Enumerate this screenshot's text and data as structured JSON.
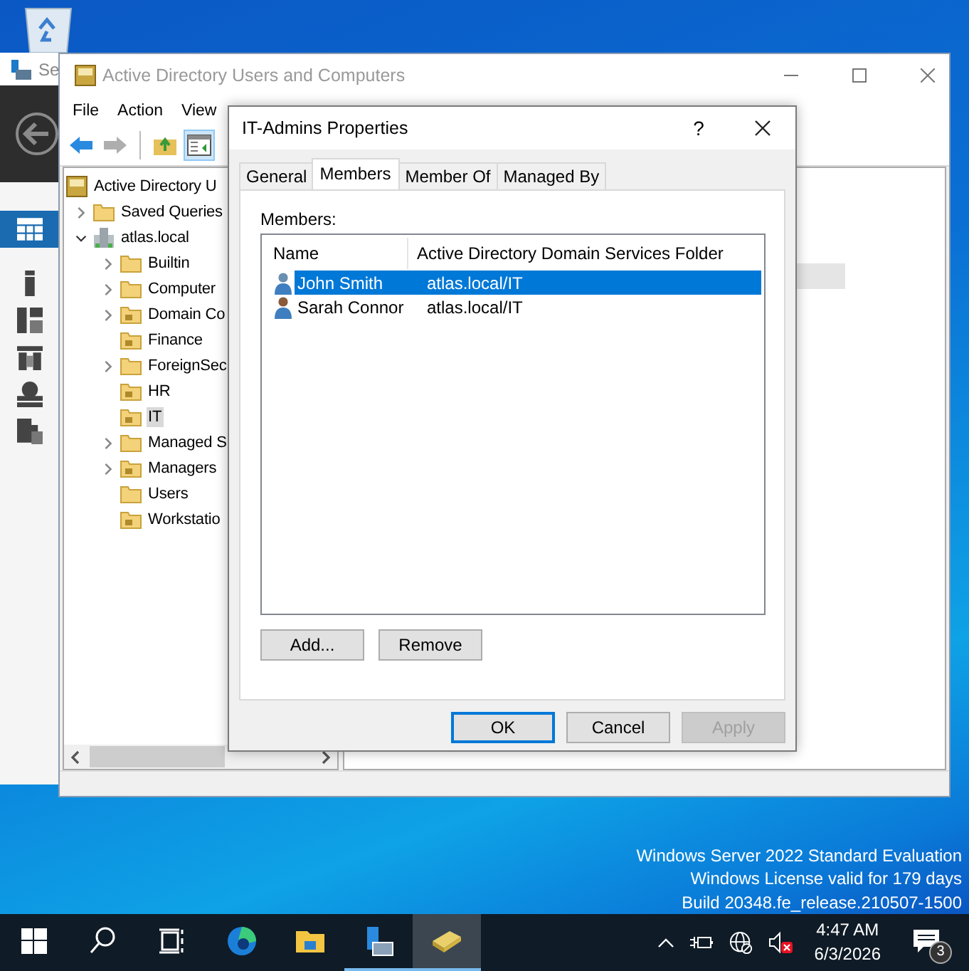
{
  "desktop": {
    "edition_text": [
      "Windows Server 2022 Standard Evaluation",
      "Windows License valid for 179 days",
      "Build 20348.fe_release.210507-1500"
    ]
  },
  "server_manager": {
    "title": "Se",
    "nav_items": [
      {
        "kind": "dashboard",
        "selected": true
      },
      {
        "kind": "server",
        "selected": false
      },
      {
        "kind": "servers",
        "selected": false
      },
      {
        "kind": "roles",
        "selected": false
      },
      {
        "kind": "network",
        "selected": false
      },
      {
        "kind": "storage",
        "selected": false
      }
    ]
  },
  "aduc": {
    "title": "Active Directory Users and Computers",
    "menu": [
      "File",
      "Action",
      "View"
    ],
    "toolbar": [
      {
        "kind": "back",
        "disabled": false,
        "pressed": false
      },
      {
        "kind": "forward",
        "disabled": true,
        "pressed": false
      },
      {
        "kind": "up",
        "disabled": false,
        "pressed": false
      },
      {
        "kind": "console-tree",
        "disabled": false,
        "pressed": true
      }
    ],
    "tree": [
      {
        "label": "Active Directory U",
        "kind": "root",
        "expandable": false,
        "selected": false,
        "children": [
          {
            "label": "Saved Queries",
            "kind": "folder",
            "expandable": true,
            "expanded": false,
            "selected": false
          },
          {
            "label": "atlas.local",
            "kind": "domain",
            "expandable": true,
            "expanded": true,
            "selected": false,
            "children": [
              {
                "label": "Builtin",
                "kind": "folder",
                "expandable": true,
                "expanded": false,
                "selected": false
              },
              {
                "label": "Computer",
                "kind": "folder",
                "expandable": true,
                "expanded": false,
                "selected": false
              },
              {
                "label": "Domain Co",
                "kind": "ou",
                "expandable": true,
                "expanded": false,
                "selected": false
              },
              {
                "label": "Finance",
                "kind": "ou",
                "expandable": false,
                "selected": false
              },
              {
                "label": "ForeignSec",
                "kind": "folder",
                "expandable": true,
                "expanded": false,
                "selected": false
              },
              {
                "label": "HR",
                "kind": "ou",
                "expandable": false,
                "selected": false
              },
              {
                "label": "IT",
                "kind": "ou",
                "expandable": false,
                "selected": true
              },
              {
                "label": "Managed S",
                "kind": "folder",
                "expandable": true,
                "expanded": false,
                "selected": false
              },
              {
                "label": "Managers",
                "kind": "ou",
                "expandable": true,
                "expanded": false,
                "selected": false
              },
              {
                "label": "Users",
                "kind": "folder",
                "expandable": false,
                "selected": false
              },
              {
                "label": "Workstatio",
                "kind": "ou",
                "expandable": false,
                "selected": false
              }
            ]
          }
        ]
      }
    ]
  },
  "dialog": {
    "title": "IT-Admins Properties",
    "help": "?",
    "tabs": [
      {
        "label": "General",
        "selected": false
      },
      {
        "label": "Members",
        "selected": true
      },
      {
        "label": "Member Of",
        "selected": false
      },
      {
        "label": "Managed By",
        "selected": false
      }
    ],
    "members_label": "Members:",
    "columns": [
      "Name",
      "Active Directory Domain Services Folder"
    ],
    "rows": [
      {
        "name": "John Smith",
        "folder": "atlas.local/IT",
        "selected": true
      },
      {
        "name": "Sarah Connor",
        "folder": "atlas.local/IT",
        "selected": false
      }
    ],
    "list_buttons": [
      "Add...",
      "Remove"
    ],
    "footer_buttons": [
      {
        "label": "OK",
        "default": true,
        "disabled": false
      },
      {
        "label": "Cancel",
        "default": false,
        "disabled": false
      },
      {
        "label": "Apply",
        "default": false,
        "disabled": true
      }
    ]
  },
  "taskbar": {
    "apps": [
      {
        "kind": "start",
        "open": false,
        "selected": false
      },
      {
        "kind": "search",
        "open": false,
        "selected": false
      },
      {
        "kind": "task-view",
        "open": false,
        "selected": false
      },
      {
        "kind": "edge",
        "open": false,
        "selected": false
      },
      {
        "kind": "explorer",
        "open": false,
        "selected": false
      },
      {
        "kind": "server-manager",
        "open": true,
        "selected": false
      },
      {
        "kind": "aduc",
        "open": true,
        "selected": true
      }
    ],
    "time": "4:47 AM",
    "date": "6/3/2026",
    "notification_count": "3"
  }
}
